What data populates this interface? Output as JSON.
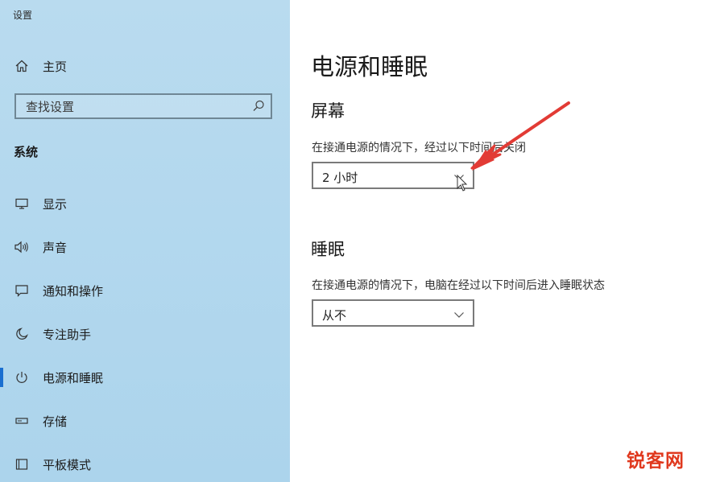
{
  "window": {
    "title": "设置"
  },
  "sidebar": {
    "home_label": "主页",
    "search_placeholder": "查找设置",
    "section_label": "系统",
    "items": [
      {
        "label": "显示",
        "icon": "monitor-icon"
      },
      {
        "label": "声音",
        "icon": "speaker-icon"
      },
      {
        "label": "通知和操作",
        "icon": "notification-icon"
      },
      {
        "label": "专注助手",
        "icon": "moon-icon"
      },
      {
        "label": "电源和睡眠",
        "icon": "power-icon",
        "selected": true
      },
      {
        "label": "存储",
        "icon": "storage-icon"
      },
      {
        "label": "平板模式",
        "icon": "tablet-icon"
      }
    ]
  },
  "main": {
    "title": "电源和睡眠",
    "screen": {
      "heading": "屏幕",
      "description": "在接通电源的情况下，经过以下时间后关闭",
      "value": "2 小时"
    },
    "sleep": {
      "heading": "睡眠",
      "description": "在接通电源的情况下，电脑在经过以下时间后进入睡眠状态",
      "value": "从不"
    }
  },
  "watermark": "锐客网",
  "colors": {
    "accent": "#1a6fd0",
    "annotation_arrow": "#e23b35",
    "watermark": "#e0381d",
    "sidebar_bg": "#b3d8ee"
  }
}
